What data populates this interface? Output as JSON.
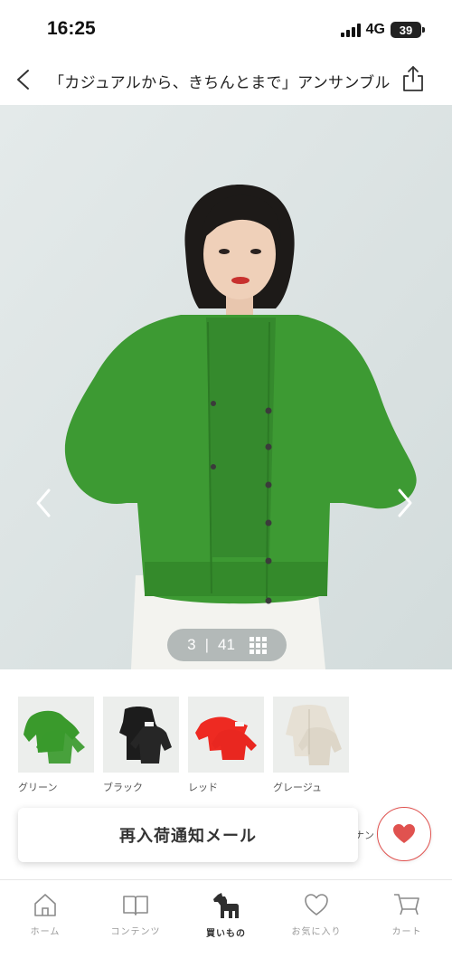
{
  "status_bar": {
    "time": "16:25",
    "network": "4G",
    "battery": "39"
  },
  "header": {
    "title": "「カジュアルから、きちんとまで」アンサンブル",
    "back_icon": "chevron-left-icon",
    "share_icon": "share-icon"
  },
  "gallery": {
    "current": "3",
    "separator": "|",
    "total": "41",
    "grid_icon": "grid-icon"
  },
  "colors": [
    {
      "name": "グリーン",
      "swatch": "#3a9a2c"
    },
    {
      "name": "ブラック",
      "swatch": "#1c1c1c"
    },
    {
      "name": "レッド",
      "swatch": "#ee2a22"
    },
    {
      "name": "グレージュ",
      "swatch": "#e6e0d4"
    }
  ],
  "actions": {
    "restock_label": "再入荷通知メール",
    "behind_text": "ナン",
    "favorite_icon": "heart-icon",
    "favorite_color": "#e0524f"
  },
  "tabbar": {
    "items": [
      {
        "label": "ホーム",
        "icon": "home-icon"
      },
      {
        "label": "コンテンツ",
        "icon": "book-icon"
      },
      {
        "label": "買いもの",
        "icon": "horse-icon",
        "active": true
      },
      {
        "label": "お気に入り",
        "icon": "heart-outline-icon"
      },
      {
        "label": "カート",
        "icon": "cart-icon"
      }
    ]
  }
}
